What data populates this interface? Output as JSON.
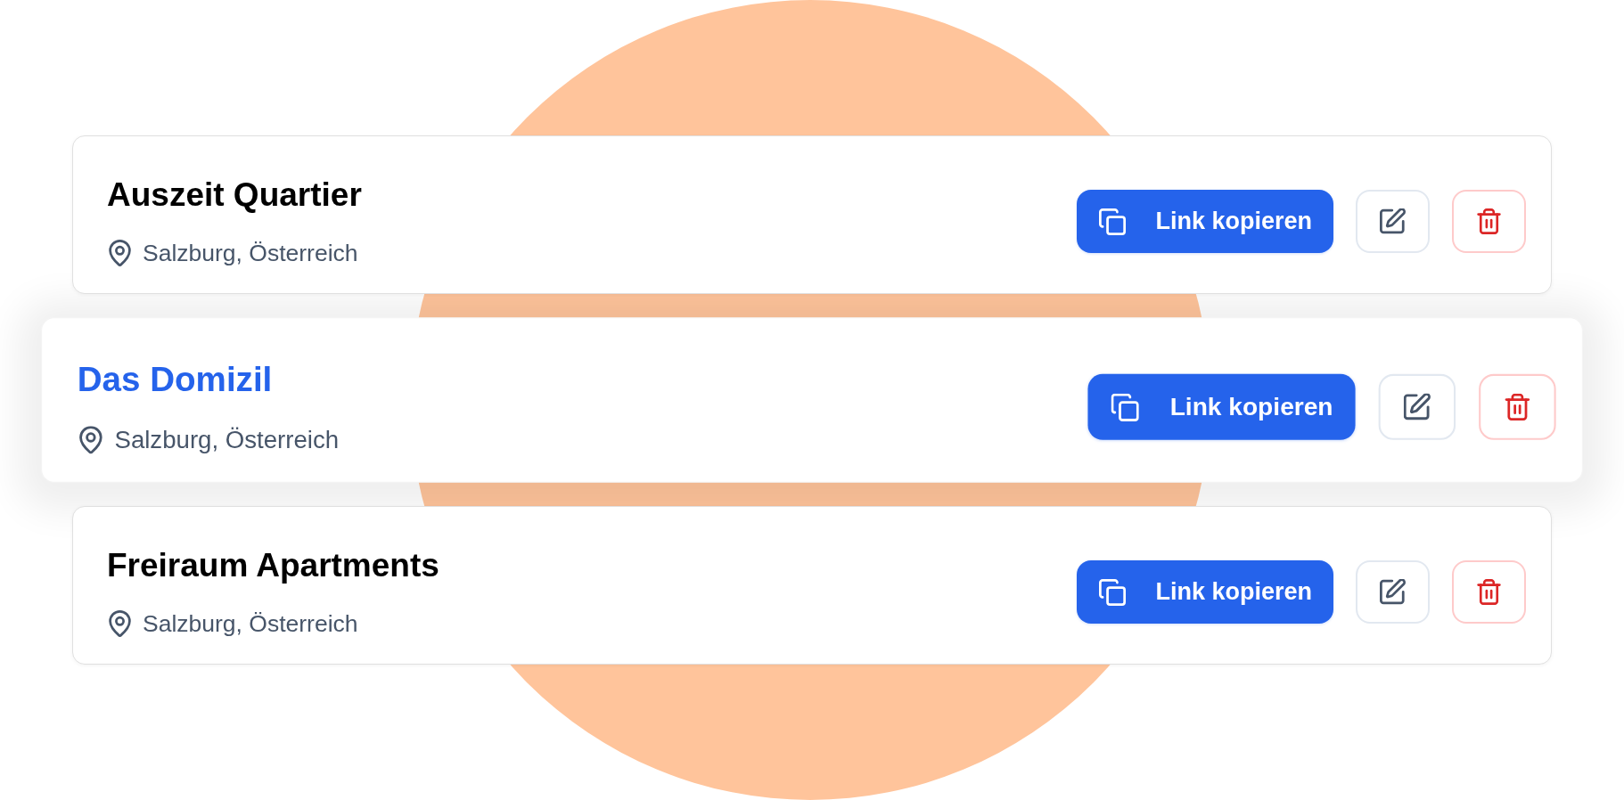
{
  "cards": [
    {
      "title": "Auszeit Quartier",
      "location": "Salzburg, Österreich",
      "selected": false,
      "copy_button": "Link kopieren"
    },
    {
      "title": "Das Domizil",
      "location": "Salzburg, Österreich",
      "selected": true,
      "copy_button": "Link kopieren"
    },
    {
      "title": "Freiraum Apartments",
      "location": "Salzburg, Österreich",
      "selected": false,
      "copy_button": "Link kopieren"
    }
  ]
}
